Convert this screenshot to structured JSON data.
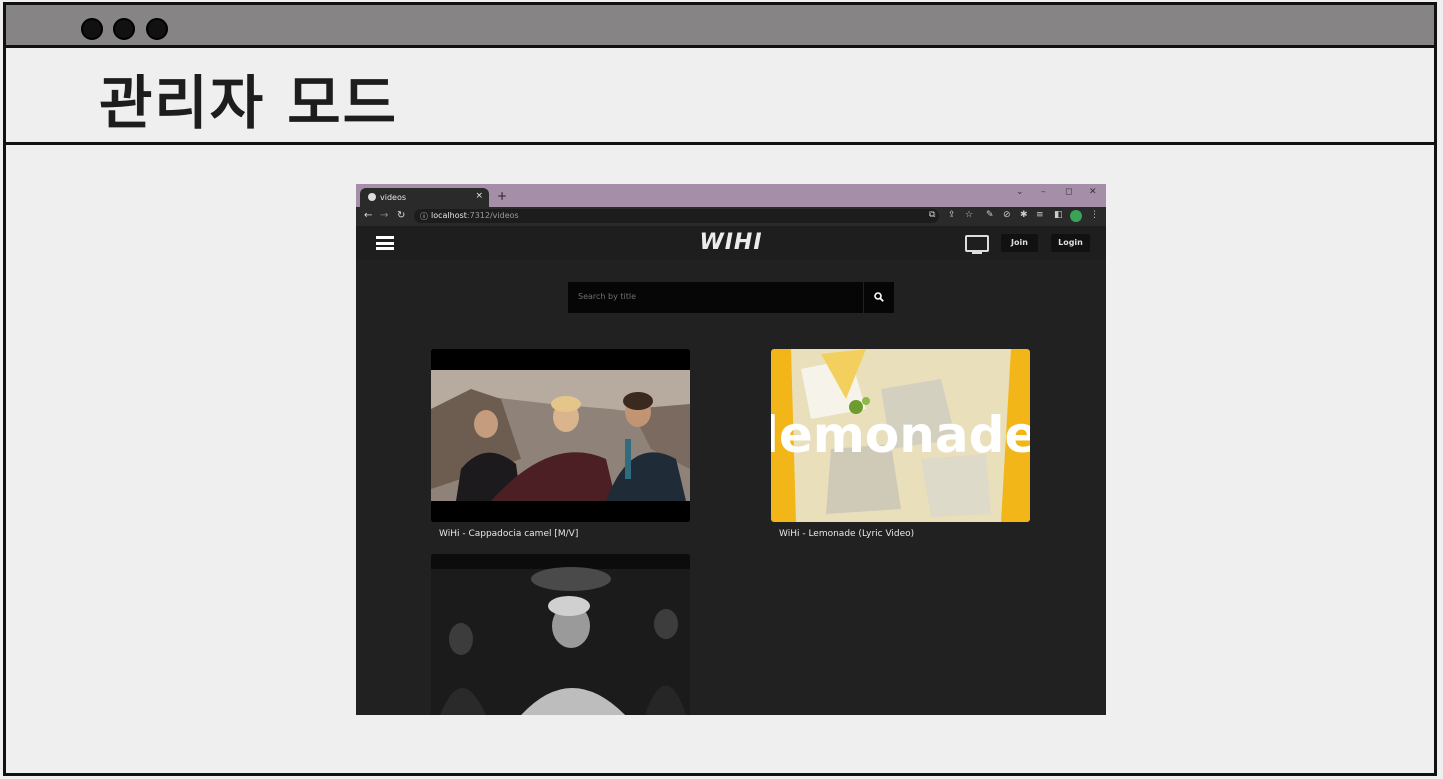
{
  "window": {
    "traffic_lights": [
      "close",
      "minimize",
      "maximize"
    ]
  },
  "header": {
    "title": "관리자 모드"
  },
  "browser": {
    "tab_title": "videos",
    "tab_close": "×",
    "new_tab": "+",
    "window_controls": [
      "⌄",
      "–",
      "◻",
      "✕"
    ],
    "url_host": "localhost",
    "url_path": ":7312/videos"
  },
  "site": {
    "logo": "WIHI",
    "join_label": "Join",
    "login_label": "Login",
    "search_placeholder": "Search by title"
  },
  "videos": [
    {
      "title": "WiHi - Cappadocia camel [M/V]",
      "thumb_icon": "video-still-outdoor-group"
    },
    {
      "title": "WiHi - Lemonade (Lyric Video)",
      "thumb_icon": "lemonade-artwork",
      "thumb_text": "lemonade"
    },
    {
      "title": "",
      "thumb_icon": "video-still-monochrome"
    }
  ],
  "colors": {
    "titlebar": "#868484",
    "tabstrip": "#a58fa8",
    "site_bg": "#212121",
    "lemon_yellow": "#f2b619"
  }
}
